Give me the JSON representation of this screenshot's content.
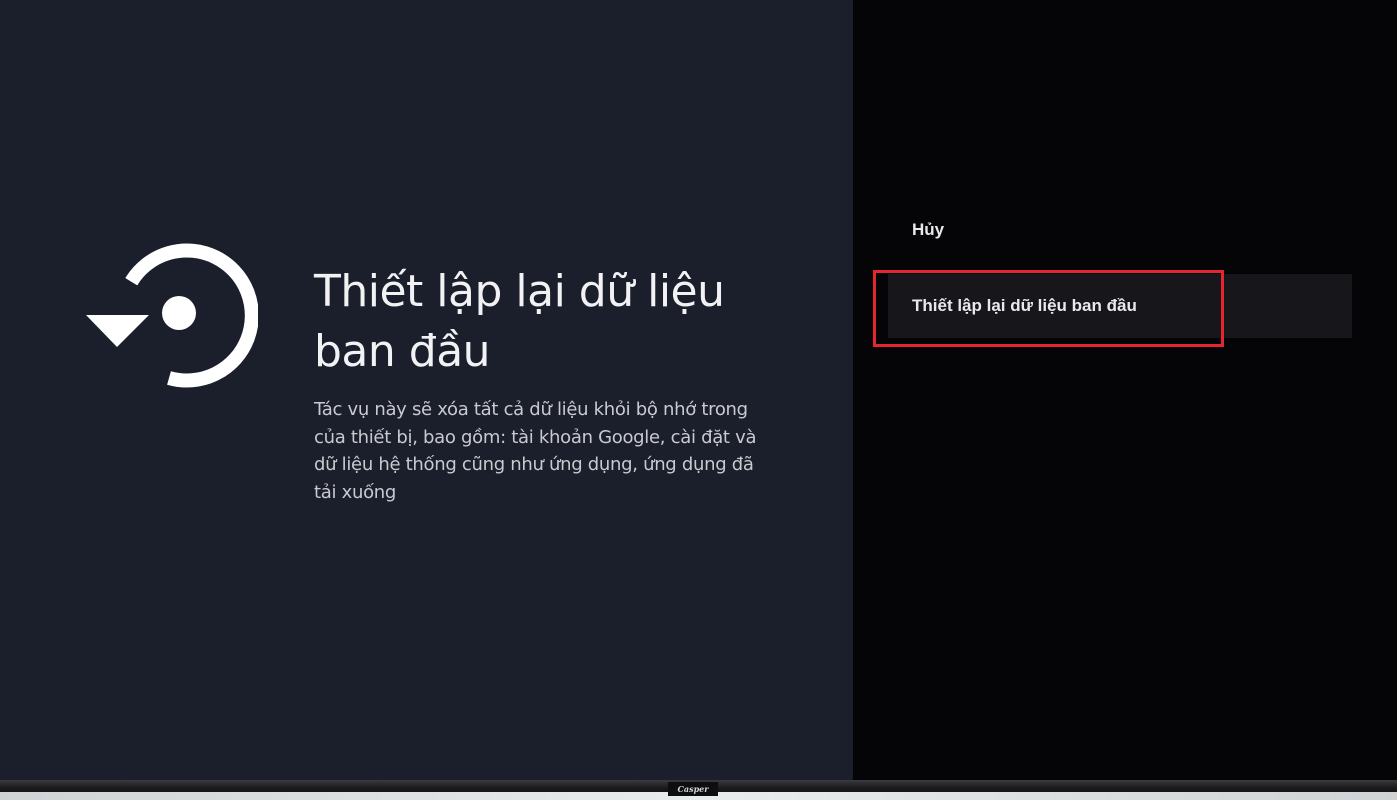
{
  "info_panel": {
    "icon": "factory-reset-icon",
    "title": "Thiết lập lại dữ liệu ban đầu",
    "description": "Tác vụ này sẽ xóa tất cả dữ liệu khỏi bộ nhớ trong của thiết bị, bao gồm: tài khoản Google, cài đặt và dữ liệu hệ thống cũng như ứng dụng, ứng dụng đã tải xuống"
  },
  "menu": {
    "items": [
      {
        "label": "Hủy"
      },
      {
        "label": "Thiết lập lại dữ liệu ban đầu",
        "focused": true
      }
    ],
    "highlight_color": "#e5262f"
  },
  "tv": {
    "brand": "Casper"
  },
  "colors": {
    "left_background": "#1b1e2b",
    "right_background": "#050507",
    "text": "#f2f2f4"
  }
}
